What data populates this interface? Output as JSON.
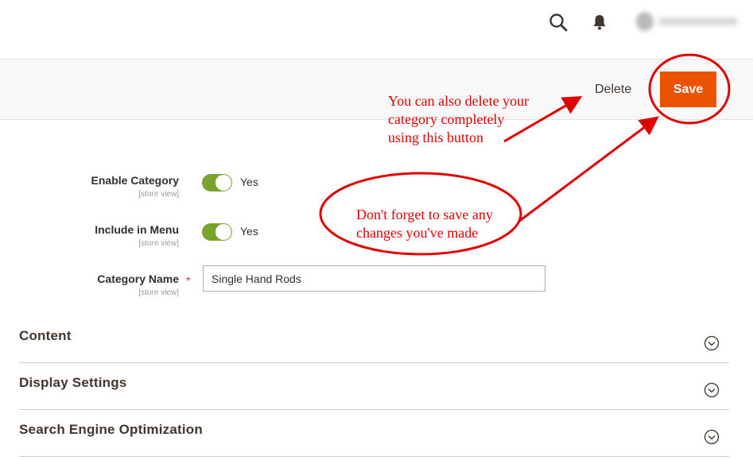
{
  "header": {
    "search_icon": "search-icon",
    "notifications_icon": "bell-icon"
  },
  "actions": {
    "delete_label": "Delete",
    "save_label": "Save"
  },
  "form": {
    "enable_category": {
      "label": "Enable Category",
      "scope": "[store view]",
      "value": "Yes"
    },
    "include_in_menu": {
      "label": "Include in Menu",
      "scope": "[store view]",
      "value": "Yes"
    },
    "category_name": {
      "label": "Category Name",
      "scope": "[store view]",
      "required_mark": "*",
      "value": "Single Hand Rods"
    }
  },
  "sections": [
    {
      "title": "Content"
    },
    {
      "title": "Display Settings"
    },
    {
      "title": "Search Engine Optimization"
    }
  ],
  "annotations": {
    "delete_note": [
      "You can also delete your",
      "category completely",
      "using this button"
    ],
    "save_note": [
      "Don't forget to save any",
      "changes you've made"
    ],
    "color": "#e00000"
  },
  "colors": {
    "save_button": "#eb5202",
    "toggle_on": "#79a22e"
  }
}
